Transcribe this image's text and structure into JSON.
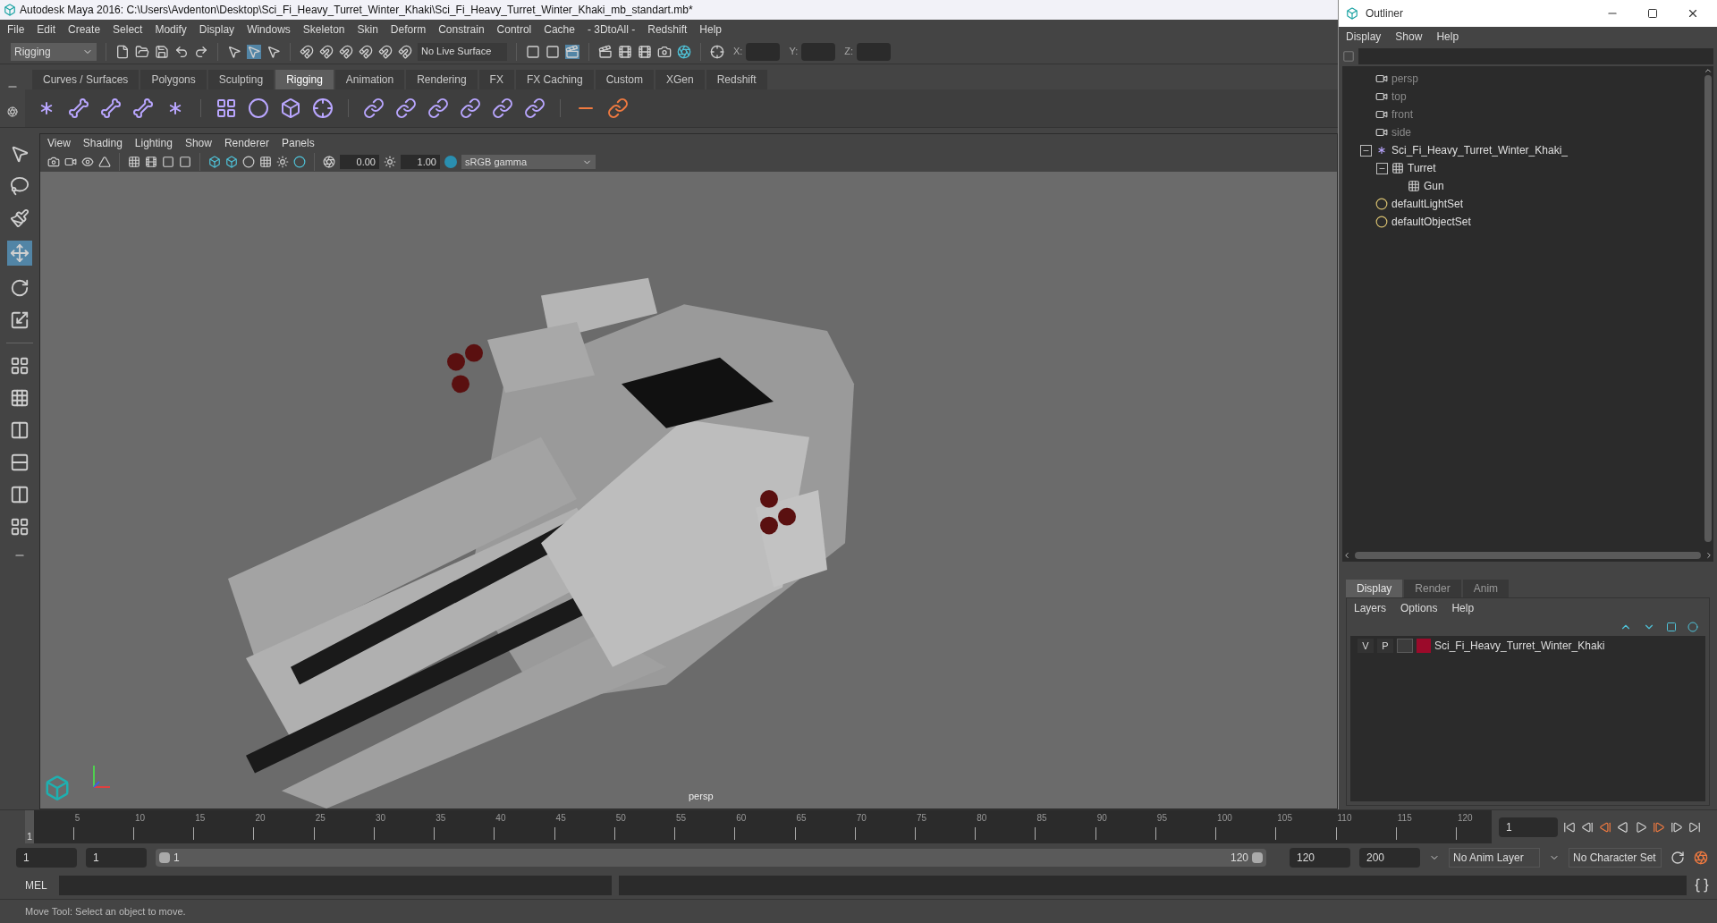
{
  "window": {
    "title": "Autodesk Maya 2016: C:\\Users\\Avdenton\\Desktop\\Sci_Fi_Heavy_Turret_Winter_Khaki\\Sci_Fi_Heavy_Turret_Winter_Khaki_mb_standart.mb*"
  },
  "menu": [
    "File",
    "Edit",
    "Create",
    "Select",
    "Modify",
    "Display",
    "Windows",
    "Skeleton",
    "Skin",
    "Deform",
    "Constrain",
    "Control",
    "Cache",
    "- 3DtoAll -",
    "Redshift",
    "Help"
  ],
  "toolbar": {
    "mode": "Rigging",
    "live_surface": "No Live Surface",
    "coords": [
      "X:",
      "Y:",
      "Z:"
    ]
  },
  "shelf_tabs": [
    {
      "label": "Curves / Surfaces",
      "selected": false
    },
    {
      "label": "Polygons",
      "selected": false
    },
    {
      "label": "Sculpting",
      "selected": false
    },
    {
      "label": "Rigging",
      "selected": true
    },
    {
      "label": "Animation",
      "selected": false
    },
    {
      "label": "Rendering",
      "selected": false
    },
    {
      "label": "FX",
      "selected": false
    },
    {
      "label": "FX Caching",
      "selected": false
    },
    {
      "label": "Custom",
      "selected": false
    },
    {
      "label": "XGen",
      "selected": false
    },
    {
      "label": "Redshift",
      "selected": false
    }
  ],
  "panel_menu": [
    "View",
    "Shading",
    "Lighting",
    "Show",
    "Renderer",
    "Panels"
  ],
  "viewport_toolbar": {
    "exposure": "0.00",
    "gamma": "1.00",
    "color_space": "sRGB gamma"
  },
  "viewport": {
    "camera_label": "persp"
  },
  "outliner": {
    "title": "Outliner",
    "menu": [
      "Display",
      "Show",
      "Help"
    ],
    "tree": [
      {
        "label": "persp",
        "kind": "camera"
      },
      {
        "label": "top",
        "kind": "camera"
      },
      {
        "label": "front",
        "kind": "camera"
      },
      {
        "label": "side",
        "kind": "camera"
      },
      {
        "label": "Sci_Fi_Heavy_Turret_Winter_Khaki_",
        "kind": "joint",
        "expanded": true,
        "children": [
          {
            "label": "Turret",
            "kind": "mesh",
            "expanded": true,
            "children": [
              {
                "label": "Gun",
                "kind": "mesh"
              }
            ]
          }
        ]
      },
      {
        "label": "defaultLightSet",
        "kind": "set"
      },
      {
        "label": "defaultObjectSet",
        "kind": "set"
      }
    ]
  },
  "layer_editor": {
    "tabs": [
      {
        "label": "Display",
        "selected": true
      },
      {
        "label": "Render",
        "selected": false
      },
      {
        "label": "Anim",
        "selected": false
      }
    ],
    "menu": [
      "Layers",
      "Options",
      "Help"
    ],
    "layers": [
      {
        "visible": "V",
        "playback": "P",
        "color": "#9b0a2a",
        "name": "Sci_Fi_Heavy_Turret_Winter_Khaki"
      }
    ]
  },
  "timeline": {
    "ticks": [
      "5",
      "10",
      "15",
      "20",
      "25",
      "30",
      "35",
      "40",
      "45",
      "50",
      "55",
      "60",
      "65",
      "70",
      "75",
      "80",
      "85",
      "90",
      "95",
      "100",
      "105",
      "110",
      "115",
      "120"
    ],
    "current_marker": "1",
    "current_frame": "1",
    "level": 0
  },
  "range": {
    "start": "1",
    "playback_start": "1",
    "slider_start": "1",
    "slider_end": "120",
    "playback_end": "120",
    "end": "200",
    "anim_layer": "No Anim Layer",
    "character_set": "No Character Set",
    "level": 1
  },
  "command_line": {
    "label": "MEL"
  },
  "status_bar": "Move Tool: Select an object to move."
}
